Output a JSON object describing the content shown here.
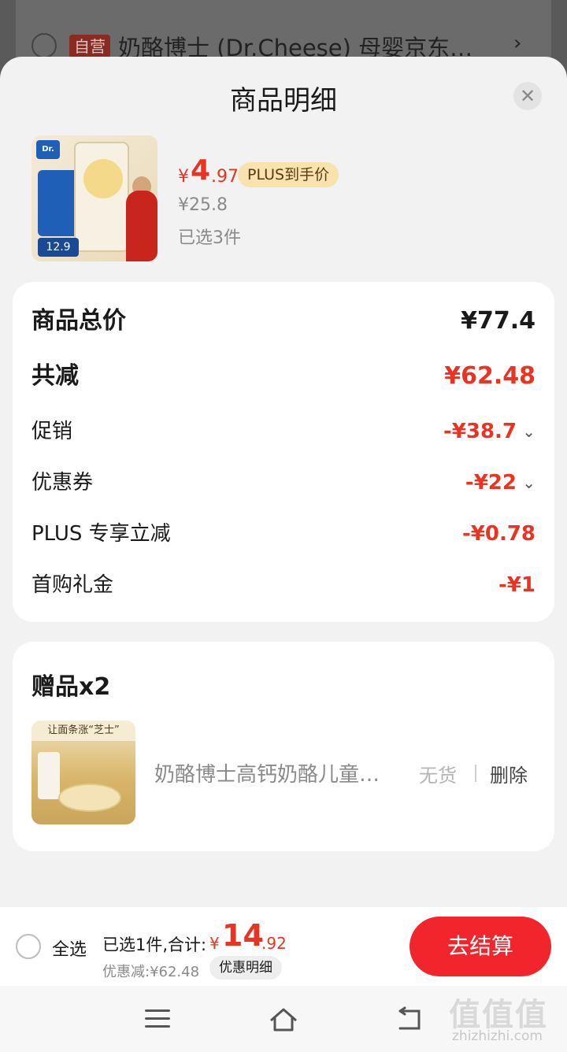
{
  "background_row": {
    "tag": "自营",
    "title": "奶酪博士 (Dr.Cheese) 母婴京东…",
    "chevron": "›"
  },
  "sheet": {
    "title": "商品明细",
    "close_icon": "✕"
  },
  "product": {
    "image_price_label": "12.9",
    "logo_text": "Dr.",
    "price_currency": "¥",
    "price_integer": "4",
    "price_decimal": ".97",
    "plus_badge": "PLUS到手价",
    "original_price": "¥25.8",
    "selected_count": "已选3件"
  },
  "summary": {
    "rows": [
      {
        "label": "商品总价",
        "value": "¥77.4"
      },
      {
        "label": "共减",
        "value": "¥62.48"
      },
      {
        "label": "促销",
        "value": "-¥38.7"
      },
      {
        "label": "优惠券",
        "value": "-¥22"
      },
      {
        "label": "PLUS 专享立减",
        "value": "-¥0.78"
      },
      {
        "label": "首购礼金",
        "value": "-¥1"
      }
    ]
  },
  "gift": {
    "title": "赠品x2",
    "image_caption": "让面条涨“芝士”",
    "name": "奶酪博士高钙奶酪儿童…",
    "stock_status": "无货",
    "delete_label": "删除"
  },
  "bottom_bar": {
    "select_all": "全选",
    "summary_text": "已选1件,合计:",
    "total_currency": "¥",
    "total_integer": "14",
    "total_decimal": ".92",
    "discount_text": "优惠减:¥62.48",
    "discount_detail": "优惠明细",
    "checkout": "去结算"
  },
  "watermark": {
    "glyphs": "值值值",
    "url": "zhizhizhi.com"
  },
  "colors": {
    "accent_red": "#e93323",
    "checkout_red": "#f3252c",
    "plus_gold": "#f8e2ad"
  }
}
